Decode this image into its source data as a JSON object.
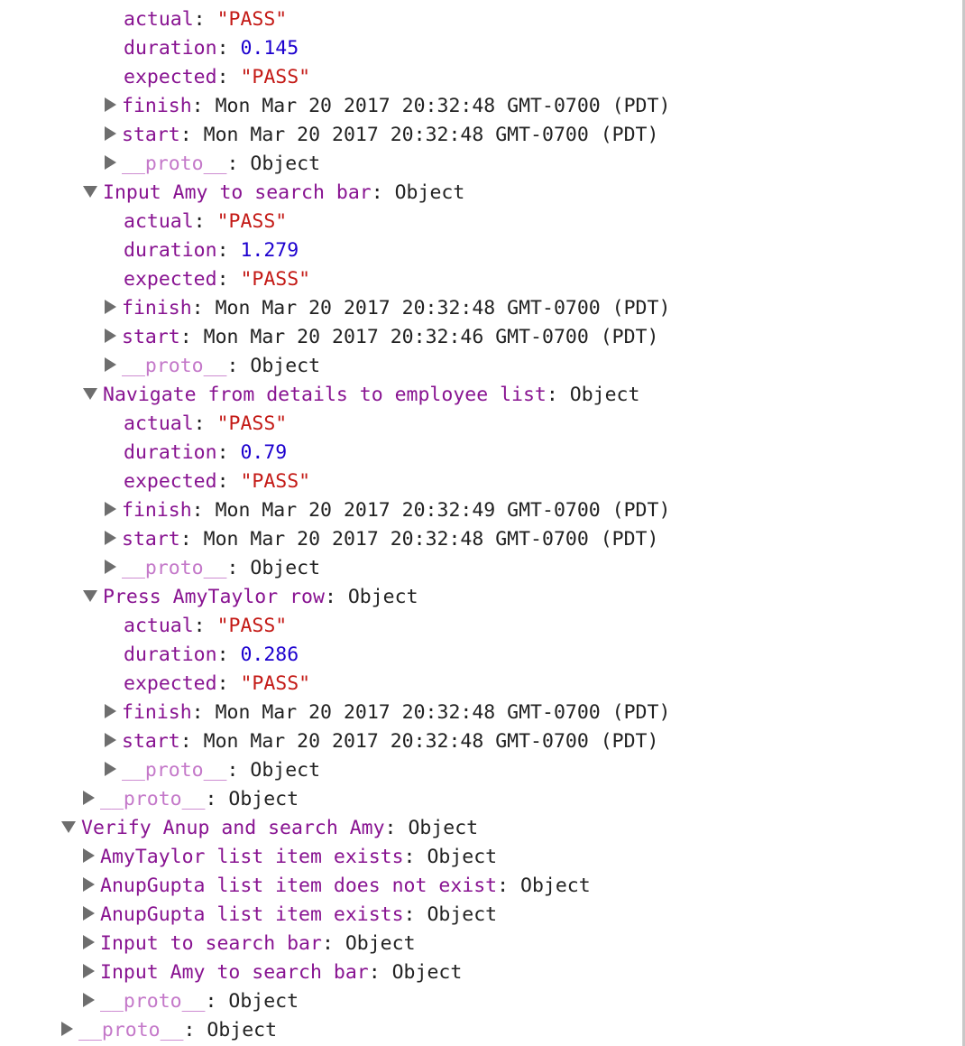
{
  "rows": [
    {
      "key": "actual",
      "sep": ": ",
      "value": "\"PASS\"",
      "kind": "str",
      "toggle": "none",
      "depth": 2
    },
    {
      "key": "duration",
      "sep": ": ",
      "value": "0.145",
      "kind": "num",
      "toggle": "none",
      "depth": 2
    },
    {
      "key": "expected",
      "sep": ": ",
      "value": "\"PASS\"",
      "kind": "str",
      "toggle": "none",
      "depth": 2
    },
    {
      "key": "finish",
      "sep": ": ",
      "value": "Mon Mar 20 2017 20:32:48 GMT-0700 (PDT)",
      "kind": "obj",
      "toggle": "collapsed",
      "depth": 2
    },
    {
      "key": "start",
      "sep": ": ",
      "value": "Mon Mar 20 2017 20:32:48 GMT-0700 (PDT)",
      "kind": "obj",
      "toggle": "collapsed",
      "depth": 2
    },
    {
      "key": "__proto__",
      "sep": ": ",
      "value": "Object",
      "kind": "obj",
      "toggle": "collapsed",
      "depth": 2,
      "proto": true
    },
    {
      "key": "Input Amy to search bar",
      "sep": ": ",
      "value": "Object",
      "kind": "obj",
      "toggle": "expanded",
      "depth": 1
    },
    {
      "key": "actual",
      "sep": ": ",
      "value": "\"PASS\"",
      "kind": "str",
      "toggle": "none",
      "depth": 2
    },
    {
      "key": "duration",
      "sep": ": ",
      "value": "1.279",
      "kind": "num",
      "toggle": "none",
      "depth": 2
    },
    {
      "key": "expected",
      "sep": ": ",
      "value": "\"PASS\"",
      "kind": "str",
      "toggle": "none",
      "depth": 2
    },
    {
      "key": "finish",
      "sep": ": ",
      "value": "Mon Mar 20 2017 20:32:48 GMT-0700 (PDT)",
      "kind": "obj",
      "toggle": "collapsed",
      "depth": 2
    },
    {
      "key": "start",
      "sep": ": ",
      "value": "Mon Mar 20 2017 20:32:46 GMT-0700 (PDT)",
      "kind": "obj",
      "toggle": "collapsed",
      "depth": 2
    },
    {
      "key": "__proto__",
      "sep": ": ",
      "value": "Object",
      "kind": "obj",
      "toggle": "collapsed",
      "depth": 2,
      "proto": true
    },
    {
      "key": "Navigate from details to employee list",
      "sep": ": ",
      "value": "Object",
      "kind": "obj",
      "toggle": "expanded",
      "depth": 1
    },
    {
      "key": "actual",
      "sep": ": ",
      "value": "\"PASS\"",
      "kind": "str",
      "toggle": "none",
      "depth": 2
    },
    {
      "key": "duration",
      "sep": ": ",
      "value": "0.79",
      "kind": "num",
      "toggle": "none",
      "depth": 2
    },
    {
      "key": "expected",
      "sep": ": ",
      "value": "\"PASS\"",
      "kind": "str",
      "toggle": "none",
      "depth": 2
    },
    {
      "key": "finish",
      "sep": ": ",
      "value": "Mon Mar 20 2017 20:32:49 GMT-0700 (PDT)",
      "kind": "obj",
      "toggle": "collapsed",
      "depth": 2
    },
    {
      "key": "start",
      "sep": ": ",
      "value": "Mon Mar 20 2017 20:32:48 GMT-0700 (PDT)",
      "kind": "obj",
      "toggle": "collapsed",
      "depth": 2
    },
    {
      "key": "__proto__",
      "sep": ": ",
      "value": "Object",
      "kind": "obj",
      "toggle": "collapsed",
      "depth": 2,
      "proto": true
    },
    {
      "key": "Press AmyTaylor row",
      "sep": ": ",
      "value": "Object",
      "kind": "obj",
      "toggle": "expanded",
      "depth": 1
    },
    {
      "key": "actual",
      "sep": ": ",
      "value": "\"PASS\"",
      "kind": "str",
      "toggle": "none",
      "depth": 2
    },
    {
      "key": "duration",
      "sep": ": ",
      "value": "0.286",
      "kind": "num",
      "toggle": "none",
      "depth": 2
    },
    {
      "key": "expected",
      "sep": ": ",
      "value": "\"PASS\"",
      "kind": "str",
      "toggle": "none",
      "depth": 2
    },
    {
      "key": "finish",
      "sep": ": ",
      "value": "Mon Mar 20 2017 20:32:48 GMT-0700 (PDT)",
      "kind": "obj",
      "toggle": "collapsed",
      "depth": 2
    },
    {
      "key": "start",
      "sep": ": ",
      "value": "Mon Mar 20 2017 20:32:48 GMT-0700 (PDT)",
      "kind": "obj",
      "toggle": "collapsed",
      "depth": 2
    },
    {
      "key": "__proto__",
      "sep": ": ",
      "value": "Object",
      "kind": "obj",
      "toggle": "collapsed",
      "depth": 2,
      "proto": true
    },
    {
      "key": "__proto__",
      "sep": ": ",
      "value": "Object",
      "kind": "obj",
      "toggle": "collapsed",
      "depth": 1,
      "proto": true
    },
    {
      "key": "Verify Anup and search Amy",
      "sep": ": ",
      "value": "Object",
      "kind": "obj",
      "toggle": "expanded",
      "depth": 0
    },
    {
      "key": "AmyTaylor list item exists",
      "sep": ": ",
      "value": "Object",
      "kind": "obj",
      "toggle": "collapsed",
      "depth": 1
    },
    {
      "key": "AnupGupta list item does not exist",
      "sep": ": ",
      "value": "Object",
      "kind": "obj",
      "toggle": "collapsed",
      "depth": 1
    },
    {
      "key": "AnupGupta list item exists",
      "sep": ": ",
      "value": "Object",
      "kind": "obj",
      "toggle": "collapsed",
      "depth": 1
    },
    {
      "key": "Input to search bar",
      "sep": ": ",
      "value": "Object",
      "kind": "obj",
      "toggle": "collapsed",
      "depth": 1
    },
    {
      "key": "Input Amy to search bar",
      "sep": ": ",
      "value": "Object",
      "kind": "obj",
      "toggle": "collapsed",
      "depth": 1
    },
    {
      "key": "__proto__",
      "sep": ": ",
      "value": "Object",
      "kind": "obj",
      "toggle": "collapsed",
      "depth": 1,
      "proto": true
    },
    {
      "key": "__proto__",
      "sep": ": ",
      "value": "Object",
      "kind": "obj",
      "toggle": "collapsed",
      "depth": -1,
      "proto": true
    }
  ]
}
